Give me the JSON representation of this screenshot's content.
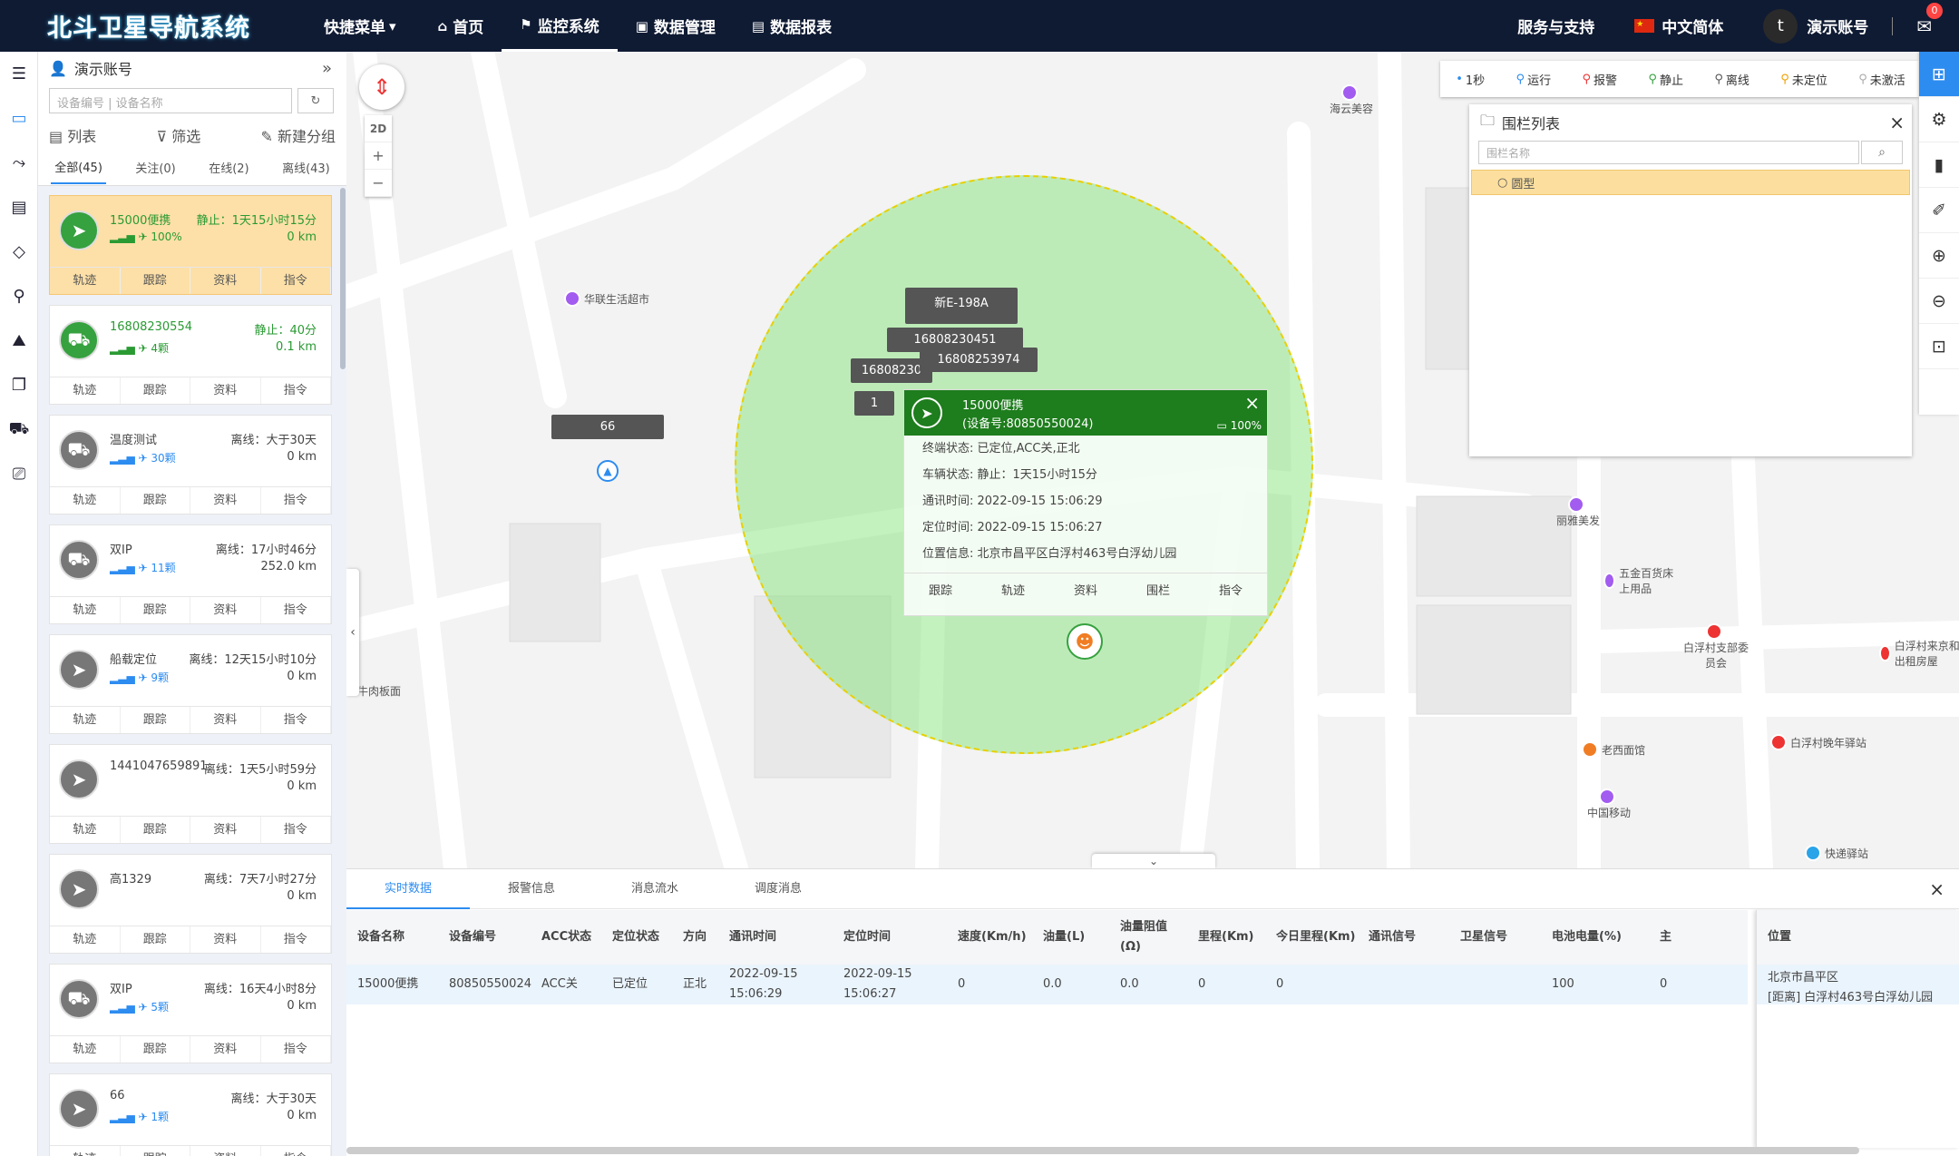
{
  "app": {
    "title": "北斗卫星导航系统"
  },
  "nav": [
    {
      "label": "快捷菜单",
      "icon": "▾"
    },
    {
      "label": "首页",
      "icon": "⌂"
    },
    {
      "label": "监控系统",
      "icon": "⚑"
    },
    {
      "label": "数据管理",
      "icon": "▣"
    },
    {
      "label": "数据报表",
      "icon": "▤"
    }
  ],
  "top": {
    "support": "服务与支持",
    "lang": "中文简体",
    "avatar": "t",
    "account": "演示账号",
    "mail_count": "0"
  },
  "left": {
    "account": "演示账号",
    "search_placeholder": "设备编号 | 设备名称",
    "tools": [
      "列表",
      "筛选",
      "新建分组"
    ],
    "tabs": [
      "全部(45)",
      "关注(0)",
      "在线(2)",
      "离线(43)"
    ],
    "devices": [
      {
        "name": "15000便携",
        "status": "静止：1天15小时15分",
        "signal": "100%",
        "km": "0 km"
      },
      {
        "name": "16808230554",
        "status": "静止：40分",
        "signal": "4颗",
        "km": "0.1 km"
      },
      {
        "name": "温度测试",
        "status": "离线：大于30天",
        "signal": "30颗",
        "km": "0 km"
      },
      {
        "name": "双IP",
        "status": "离线：17小时46分",
        "signal": "11颗",
        "km": "252.0 km"
      },
      {
        "name": "船载定位",
        "status": "离线：12天15小时10分",
        "signal": "9颗",
        "km": "0 km"
      },
      {
        "name": "1441047659891",
        "status": "离线：1天5小时59分",
        "signal": "",
        "km": "0 km"
      },
      {
        "name": "高1329",
        "status": "离线：7天7小时27分",
        "signal": "",
        "km": "0 km"
      },
      {
        "name": "双IP",
        "status": "离线：16天4小时8分",
        "signal": "5颗",
        "km": "0 km"
      },
      {
        "name": "66",
        "status": "离线：大于30天",
        "signal": "1颗",
        "km": "0 km"
      }
    ],
    "actions": [
      "轨迹",
      "跟踪",
      "资料",
      "指令"
    ]
  },
  "map": {
    "mode": "2D",
    "pois": [
      "海云美容",
      "华联生活超市",
      "丽雅美发",
      "五金百货床上用品",
      "白浮村支部委员会",
      "白浮村来京和出租房屋",
      "老西面馆",
      "白浮村晚年驿站",
      "中国移动",
      "快递驿站",
      "牛肉板面"
    ],
    "labels": [
      "新E-198A",
      "16808230451",
      "16808253974",
      "16808230",
      "1",
      "66"
    ],
    "legend": [
      "1秒",
      "运行",
      "报警",
      "静止",
      "离线",
      "未定位",
      "未激活"
    ],
    "fence": {
      "title": "围栏列表",
      "placeholder": "围栏名称",
      "item": "圆型"
    },
    "popup": {
      "name": "15000便携",
      "id": "(设备号:80850550024)",
      "battery": "100%",
      "rows": [
        "终端状态: 已定位,ACC关,正北",
        "车辆状态: 静止：1天15小时15分",
        "通讯时间: 2022-09-15 15:06:29",
        "定位时间: 2022-09-15 15:06:27",
        "位置信息: 北京市昌平区白浮村463号白浮幼儿园"
      ],
      "actions": [
        "跟踪",
        "轨迹",
        "资料",
        "围栏",
        "指令"
      ]
    }
  },
  "bottom": {
    "tabs": [
      "实时数据",
      "报警信息",
      "消息流水",
      "调度消息"
    ],
    "headers": [
      "设备名称",
      "设备编号",
      "ACC状态",
      "定位状态",
      "方向",
      "通讯时间",
      "定位时间",
      "速度(Km/h)",
      "油量(L)",
      "油量阻值(Ω)",
      "里程(Km)",
      "今日里程(Km)",
      "通讯信号",
      "卫星信号",
      "电池电量(%)",
      "主"
    ],
    "row": [
      "15000便携",
      "80850550024",
      "ACC关",
      "已定位",
      "正北",
      "2022-09-15 15:06:29",
      "2022-09-15 15:06:27",
      "0",
      "0.0",
      "0.0",
      "0",
      "0",
      "",
      "",
      "100",
      "0"
    ],
    "pos_header": "位置",
    "pos_line1": "北京市昌平区",
    "pos_line2": "[距离] 白浮村463号白浮幼儿园"
  }
}
